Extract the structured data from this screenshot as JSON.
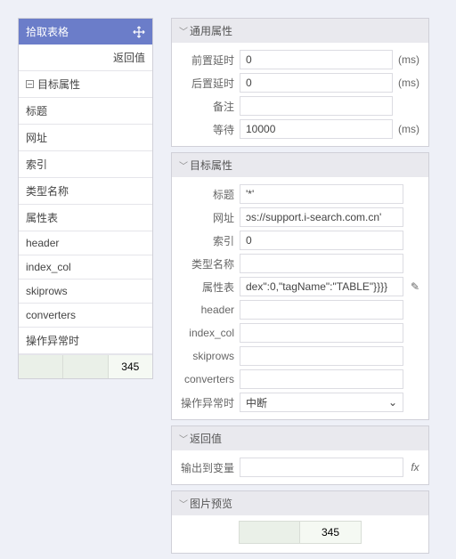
{
  "left": {
    "title": "拾取表格",
    "return_label": "返回值",
    "group_label": "目标属性",
    "rows": [
      "标题",
      "网址",
      "索引",
      "类型名称",
      "属性表",
      "header",
      "index_col",
      "skiprows",
      "converters",
      "操作异常时"
    ],
    "table": [
      "",
      "",
      "345"
    ]
  },
  "sections": {
    "general": {
      "title": "通用属性",
      "preDelay": {
        "label": "前置延时",
        "value": "0",
        "unit": "(ms)"
      },
      "postDelay": {
        "label": "后置延时",
        "value": "0",
        "unit": "(ms)"
      },
      "remark": {
        "label": "备注",
        "value": ""
      },
      "wait": {
        "label": "等待",
        "value": "10000",
        "unit": "(ms)"
      }
    },
    "target": {
      "title": "目标属性",
      "caption": {
        "label": "标题",
        "value": "'*'"
      },
      "url": {
        "label": "网址",
        "value": "ɔs://support.i-search.com.cn'"
      },
      "index": {
        "label": "索引",
        "value": "0"
      },
      "typeName": {
        "label": "类型名称",
        "value": ""
      },
      "attrTable": {
        "label": "属性表",
        "value": "dex\":0,\"tagName\":\"TABLE\"}}}}"
      },
      "header": {
        "label": "header",
        "value": ""
      },
      "indexCol": {
        "label": "index_col",
        "value": ""
      },
      "skiprows": {
        "label": "skiprows",
        "value": ""
      },
      "converters": {
        "label": "converters",
        "value": ""
      },
      "onError": {
        "label": "操作异常时",
        "value": "中断"
      }
    },
    "return": {
      "title": "返回值",
      "outVar": {
        "label": "输出到变量",
        "value": ""
      }
    },
    "preview": {
      "title": "图片预览",
      "cells": [
        "",
        "345"
      ]
    }
  }
}
